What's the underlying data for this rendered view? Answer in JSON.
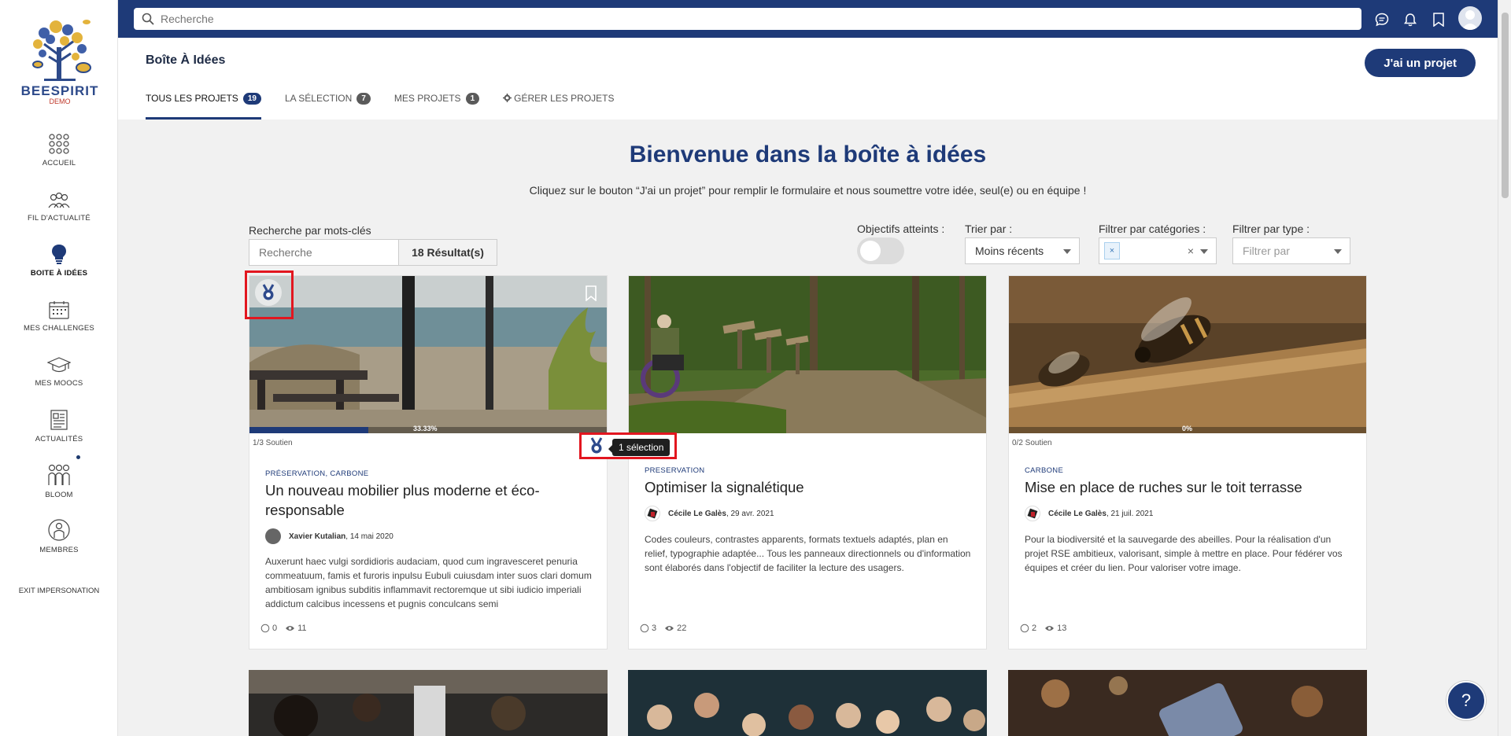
{
  "sidebar": {
    "logo_text": "BEESPIRIT",
    "logo_sub": "DEMO",
    "items": [
      {
        "label": "ACCUEIL"
      },
      {
        "label": "FIL D'ACTUALITÉ"
      },
      {
        "label": "BOITE À IDÉES"
      },
      {
        "label": "MES CHALLENGES"
      },
      {
        "label": "MES MOOCS"
      },
      {
        "label": "ACTUALITÉS"
      },
      {
        "label": "BLOOM"
      },
      {
        "label": "MEMBRES"
      }
    ],
    "exit_label": "EXIT IMPERSONATION"
  },
  "topbar": {
    "search_placeholder": "Recherche"
  },
  "header": {
    "title": "Boîte À Idées",
    "cta_label": "J'ai un projet",
    "tabs": [
      {
        "label": "TOUS LES PROJETS",
        "count": "19"
      },
      {
        "label": "LA SÉLECTION",
        "count": "7"
      },
      {
        "label": "MES PROJETS",
        "count": "1"
      },
      {
        "label": "GÉRER LES PROJETS"
      }
    ]
  },
  "welcome": {
    "title": "Bienvenue dans la boîte à idées",
    "subtitle": "Cliquez sur le bouton “J'ai un projet” pour remplir le formulaire et nous soumettre votre idée, seul(e) ou en équipe !"
  },
  "filters": {
    "keyword_label": "Recherche par mots-clés",
    "keyword_placeholder": "Recherche",
    "results": "18 Résultat(s)",
    "objectives_label": "Objectifs atteints :",
    "objectives_on": false,
    "sort_label": "Trier par :",
    "sort_value": "Moins récents",
    "category_label": "Filtrer par catégories :",
    "category_chip": "×",
    "category_clear": "×",
    "type_label": "Filtrer par type :",
    "type_placeholder": "Filtrer par"
  },
  "cards": [
    {
      "category": "PRÉSERVATION, CARBONE",
      "title": "Un nouveau mobilier plus moderne et éco-responsable",
      "author": "Xavier Kutalian",
      "date": ", 14 mai 2020",
      "support": "1/3 Soutien",
      "progress_text": "33.33%",
      "progress": 0.3333,
      "description": "Auxerunt haec vulgi sordidioris audaciam, quod cum ingravesceret penuria commeatuum, famis et furoris inpulsu Eubuli cuiusdam inter suos clari domum ambitiosam ignibus subditis inflammavit rectoremque ut sibi iudicio imperiali addictum calcibus incessens et pugnis conculcans semi",
      "comments": "0",
      "views": "11"
    },
    {
      "category": "PRESERVATION",
      "title": "Optimiser la signalétique",
      "author": "Cécile Le Galès",
      "date": ", 29 avr. 2021",
      "description": "Codes couleurs, contrastes apparents, formats textuels adaptés, plan en relief, typographie adaptée... Tous les panneaux directionnels ou d'information sont élaborés dans l'objectif de faciliter la lecture des usagers.",
      "comments": "3",
      "views": "22"
    },
    {
      "category": "CARBONE",
      "title": "Mise en place de ruches sur le toit terrasse",
      "author": "Cécile Le Galès",
      "date": ", 21 juil. 2021",
      "support": "0/2 Soutien",
      "progress_text": "0%",
      "progress": 0,
      "description": "Pour la biodiversité et la sauvegarde des abeilles. Pour la réalisation d'un projet RSE ambitieux, valorisant, simple à mettre en place. Pour fédérer vos équipes et créer du lien. Pour valoriser votre image.",
      "comments": "2",
      "views": "13"
    }
  ],
  "tooltip": "1 sélection",
  "help_label": "?",
  "colors": {
    "primary": "#1e3a78",
    "highlight": "#e2161f"
  }
}
